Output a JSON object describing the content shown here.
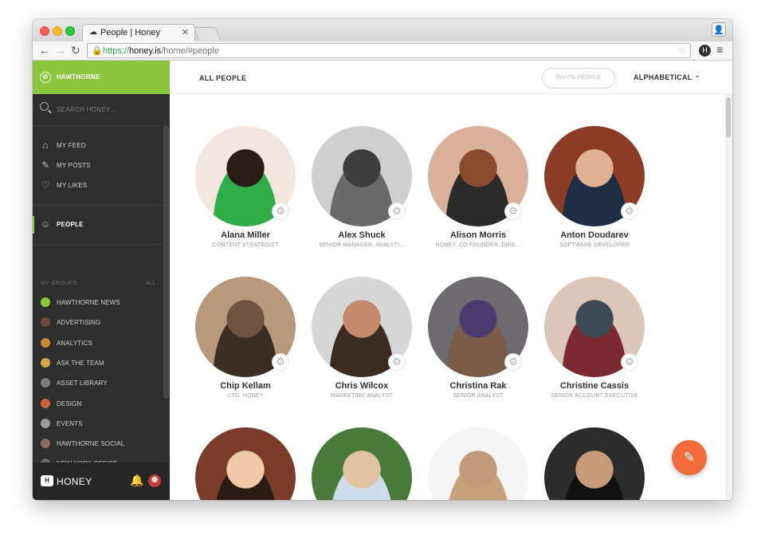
{
  "browser": {
    "tab_title": "People | Honey",
    "tab_icon": "honey-favicon",
    "url_scheme": "https://",
    "url_host": "honey.is",
    "url_path": "/home/#people"
  },
  "sidebar": {
    "org_name": "HAWTHORNE",
    "search_placeholder": "SEARCH HONEY...",
    "nav": [
      {
        "label": "MY FEED",
        "icon": "home-icon"
      },
      {
        "label": "MY POSTS",
        "icon": "edit-icon"
      },
      {
        "label": "MY LIKES",
        "icon": "heart-icon"
      }
    ],
    "people_label": "PEOPLE",
    "groups_header": "MY GROUPS",
    "groups_all": "ALL",
    "groups": [
      {
        "label": "HAWTHORNE NEWS",
        "color": "#8cc63f"
      },
      {
        "label": "ADVERTISING",
        "color": "#6b4a3a"
      },
      {
        "label": "ANALYTICS",
        "color": "#c88a3a"
      },
      {
        "label": "ASK THE TEAM",
        "color": "#d4a64a"
      },
      {
        "label": "ASSET LIBRARY",
        "color": "#7a7a7a"
      },
      {
        "label": "DESIGN",
        "color": "#c8643a"
      },
      {
        "label": "EVENTS",
        "color": "#9a9a9a"
      },
      {
        "label": "HAWTHORNE SOCIAL",
        "color": "#8a6a5a"
      },
      {
        "label": "NEW YORK OFFICE",
        "color": "#6a6a6a"
      }
    ],
    "footer_brand": "HONEY"
  },
  "main": {
    "title": "ALL PEOPLE",
    "invite_label": "INVITE PEOPLE",
    "sort_label": "ALPHABETICAL",
    "people": [
      {
        "name": "Alana Miller",
        "title": "CONTENT STRATEGIST"
      },
      {
        "name": "Alex Shuck",
        "title": "SENIOR MANAGER, ANALYTI..."
      },
      {
        "name": "Alison Morris",
        "title": "HONEY. CO-FOUNDER. DIRE..."
      },
      {
        "name": "Anton Doudarev",
        "title": "SOFTWARE DEVELOPER"
      },
      {
        "name": "Chip Kellam",
        "title": "CTO, HONEY"
      },
      {
        "name": "Chris Wilcox",
        "title": "MARKETING ANALYST"
      },
      {
        "name": "Christina Rak",
        "title": "SENIOR ANALYST"
      },
      {
        "name": "Christine Cassis",
        "title": "SENIOR ACCOUNT EXECUTIVE"
      },
      {
        "name": "",
        "title": ""
      },
      {
        "name": "",
        "title": ""
      },
      {
        "name": "",
        "title": ""
      },
      {
        "name": "",
        "title": ""
      }
    ]
  },
  "colors": {
    "accent_green": "#8cc63f",
    "sidebar_bg": "#2e2e2e",
    "fab_orange": "#f26b3a"
  }
}
